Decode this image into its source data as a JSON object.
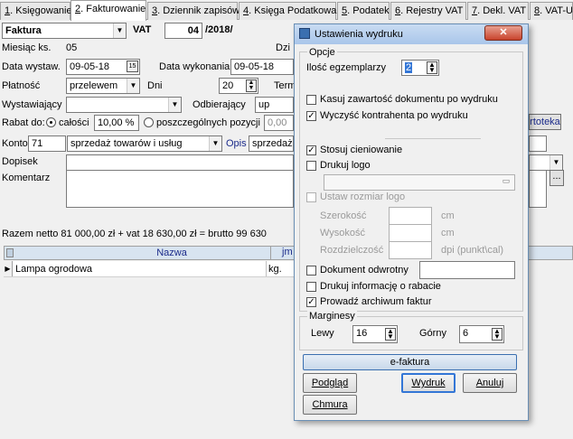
{
  "tabs": [
    {
      "num": "1",
      "label": ". Księgowanie"
    },
    {
      "num": "2",
      "label": ". Fakturowanie"
    },
    {
      "num": "3",
      "label": ". Dziennik zapisów"
    },
    {
      "num": "4",
      "label": ". Księga Podatkowa"
    },
    {
      "num": "5",
      "label": ". Podatek"
    },
    {
      "num": "6",
      "label": ". Rejestry VAT"
    },
    {
      "num": "7",
      "label": ". Dekl. VAT"
    },
    {
      "num": "8",
      "label": ". VAT-UE"
    }
  ],
  "form": {
    "doc_type": "Faktura",
    "vat_label": "VAT",
    "number": "04",
    "year_suffix": "/2018/",
    "miesiac_label": "Miesiąc ks.",
    "miesiac_value": "05",
    "dz_label": "Dzi",
    "data_wystaw_label": "Data wystaw.",
    "data_wystaw": "09-05-18",
    "data_wyk_label": "Data wykonania",
    "data_wyk": "09-05-18",
    "platnosc_label": "Płatność",
    "platnosc": "przelewem",
    "dni_label": "Dni",
    "dni": "20",
    "termin_label": "Term",
    "wystawiajacy_label": "Wystawiający",
    "odbierajacy_label": "Odbierający",
    "odbierajacy": "up",
    "rabat_label": "Rabat do:",
    "calosci_label": "całości",
    "rabat_value": "10,00 %",
    "poszczegolnych_label": "poszczególnych pozycji",
    "rabat2": "0,00",
    "kartoteka_label": "rtoteka",
    "konto_label": "Konto",
    "konto_num": "71",
    "konto_desc": "sprzedaż towarów i usług",
    "opis_label": "Opis",
    "opis_value": "sprzedaż",
    "dopisek_label": "Dopisek",
    "komentarz_label": "Komentarz",
    "razem_line": "Razem    netto  81 000,00 zł  +  vat  18 630,00 zł  =  brutto  99 630"
  },
  "grid": {
    "col_nazwa": "Nazwa",
    "col_jm": "jm",
    "row_nazwa": "Lampa ogrodowa",
    "row_jm": "kg."
  },
  "dialog": {
    "title": "Ustawienia wydruku",
    "opcje_label": "Opcje",
    "ilosc_label": "Ilość egzemplarzy",
    "ilosc_value": "2",
    "kasuj_label": "Kasuj zawartość dokumentu po wydruku",
    "wyczysc_label": "Wyczyść kontrahenta po wydruku",
    "stosuj_label": "Stosuj cieniowanie",
    "drukuj_logo_label": "Drukuj logo",
    "ustaw_rozmiar_label": "Ustaw rozmiar logo",
    "szerokosc_label": "Szerokość",
    "wysokosc_label": "Wysokość",
    "rozdzielczosc_label": "Rozdzielczość",
    "unit_cm": "cm",
    "unit_dpi": "dpi (punkt\\cal)",
    "odwrotny_label": "Dokument odwrotny",
    "rabat_info_label": "Drukuj informację o rabacie",
    "archiwum_label": "Prowadź archiwum faktur",
    "marginesy_label": "Marginesy",
    "lewy_label": "Lewy",
    "lewy_value": "16",
    "gorny_label": "Górny",
    "gorny_value": "6",
    "efaktura_label": "e-faktura",
    "podglad_label": "Podgląd",
    "wydruk_label": "Wydruk",
    "anuluj_label": "Anuluj",
    "chmura_label": "Chmura",
    "close_glyph": "✕",
    "checked_glyph": "✓"
  }
}
